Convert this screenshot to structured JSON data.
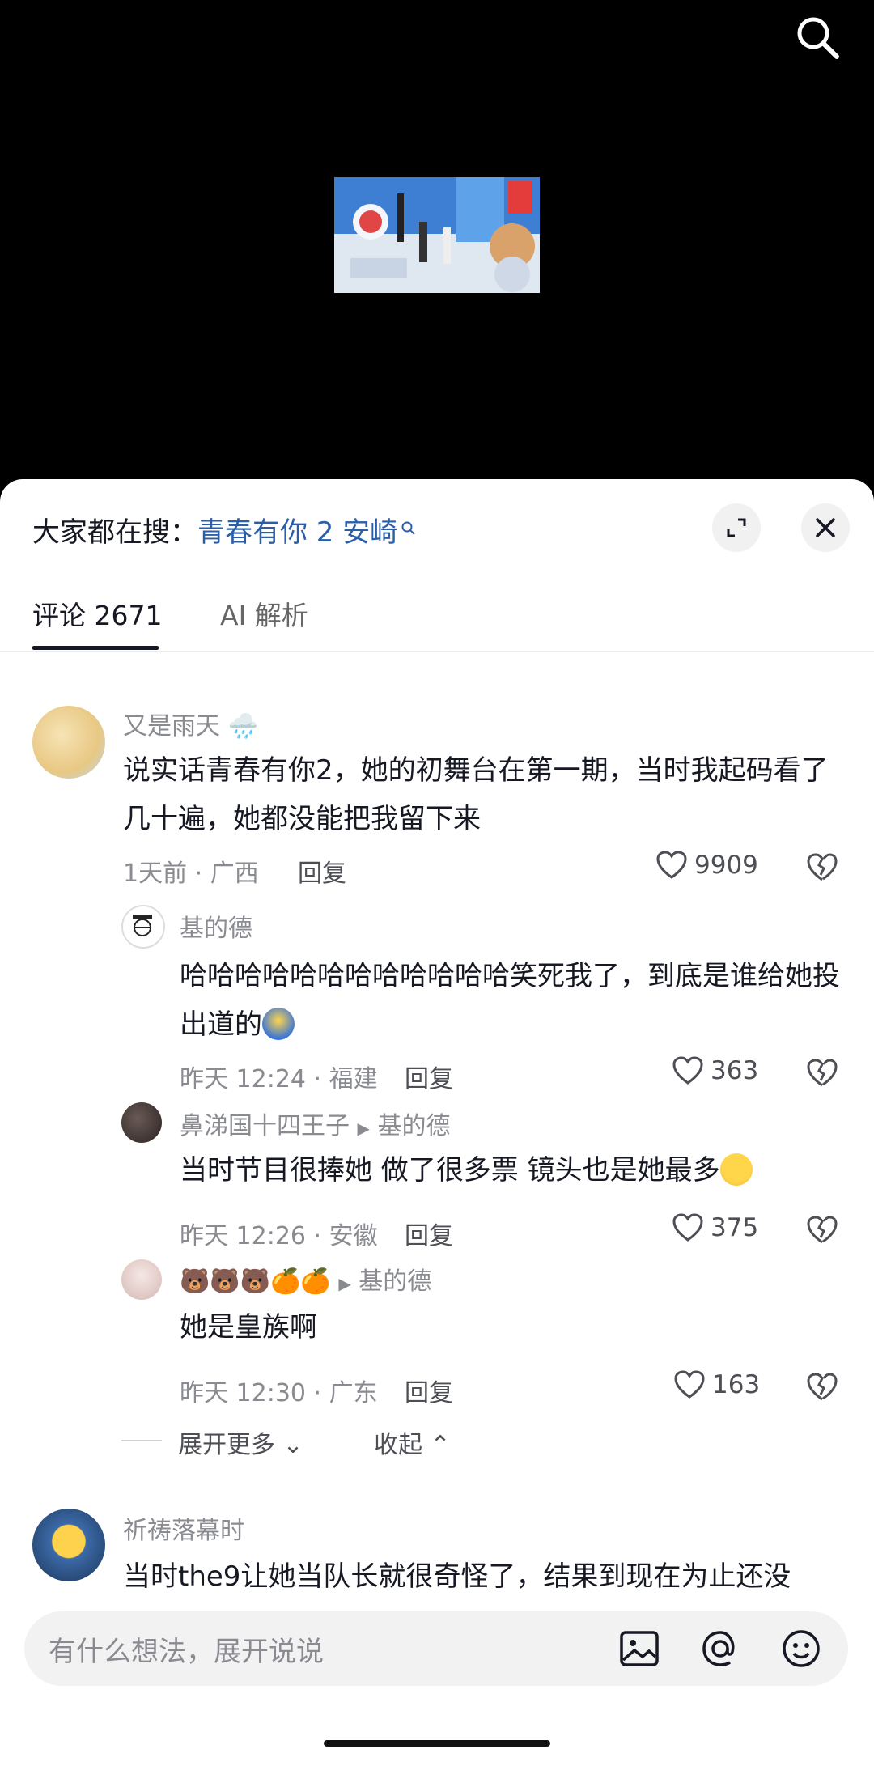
{
  "hot_search": {
    "prefix": "大家都在搜：",
    "keyword": "青春有你 2 安崎"
  },
  "tabs": [
    {
      "label": "评论 2671"
    },
    {
      "label": "AI 解析"
    }
  ],
  "comments": [
    {
      "user": "又是雨天",
      "text": "说实话青春有你2，她的初舞台在第一期，当时我起码看了几十遍，她都没能把我留下来",
      "meta": "1天前 · 广西",
      "reply": "回复",
      "likes": "9909"
    },
    {
      "user": "基的德",
      "text": "哈哈哈哈哈哈哈哈哈哈哈哈笑死我了，到底是谁给她投出道的",
      "meta": "昨天 12:24 · 福建",
      "reply": "回复",
      "likes": "363"
    },
    {
      "user": "鼻涕国十四王子",
      "reply_to": "基的德",
      "text": "当时节目很捧她 做了很多票 镜头也是她最多",
      "meta": "昨天 12:26 · 安徽",
      "reply": "回复",
      "likes": "375"
    },
    {
      "user": "🐻🐻🐻🍊🍊",
      "reply_to": "基的德",
      "text": "她是皇族啊",
      "meta": "昨天 12:30 · 广东",
      "reply": "回复",
      "likes": "163"
    },
    {
      "user": "祈祷落幕时",
      "text": "当时the9让她当队长就很奇怪了，结果到现在为止还没"
    }
  ],
  "expand": {
    "more": "展开更多",
    "collapse": "收起"
  },
  "input": {
    "placeholder": "有什么想法，展开说说"
  }
}
